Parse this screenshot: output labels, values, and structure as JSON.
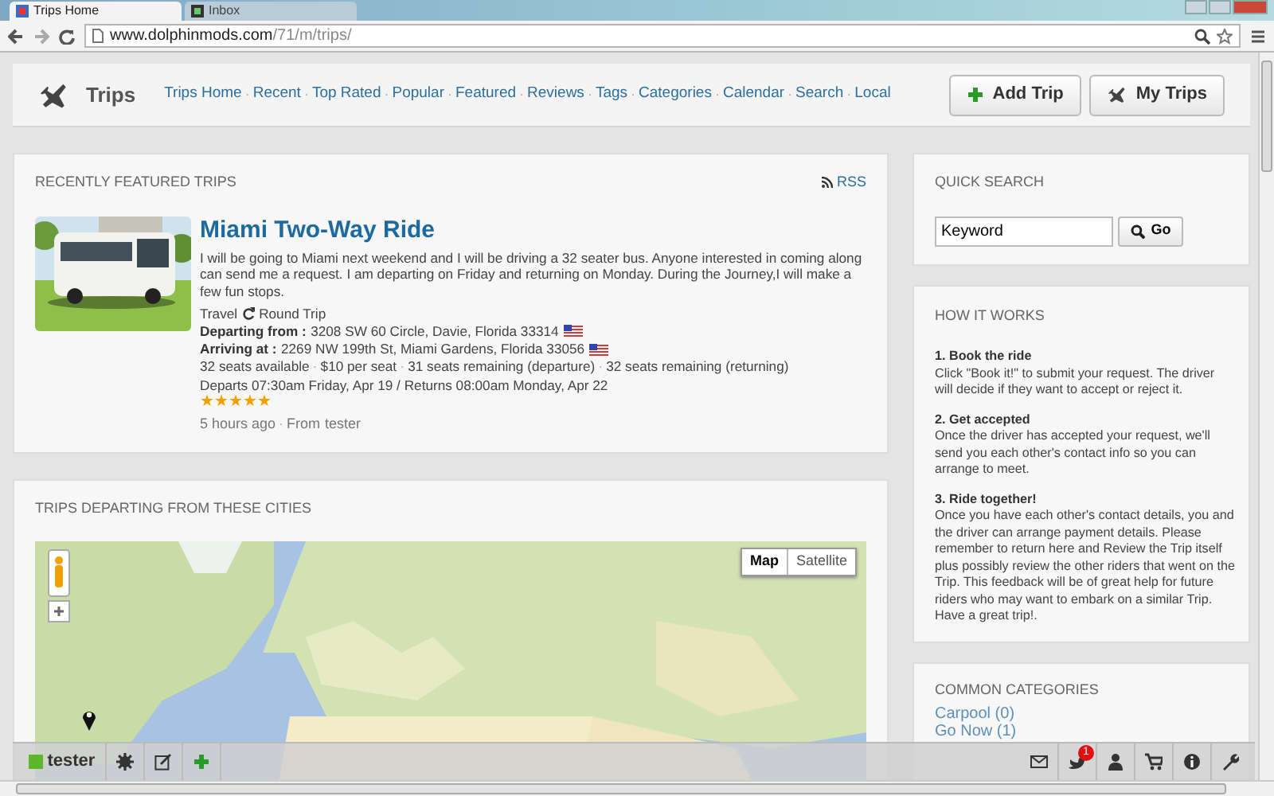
{
  "browser": {
    "tabs": [
      {
        "title": "Trips Home",
        "selected": true
      },
      {
        "title": "Inbox",
        "selected": false
      }
    ],
    "url_host": "www.dolphinmods.com",
    "url_path": "/71/m/trips/"
  },
  "header": {
    "title": "Trips",
    "separator": "·",
    "nav": [
      "Trips Home",
      "Recent",
      "Top Rated",
      "Popular",
      "Featured",
      "Reviews",
      "Tags",
      "Categories",
      "Calendar",
      "Search",
      "Local"
    ],
    "buttons": [
      {
        "label": "Add Trip",
        "kind": "add"
      },
      {
        "label": "My Trips",
        "kind": "plane"
      }
    ]
  },
  "featured": {
    "heading": "RECENTLY FEATURED TRIPS",
    "rss": "RSS",
    "trip": {
      "title": "Miami Two-Way Ride",
      "description": "I will be going to Miami next weekend and I will be driving a 32 seater bus. Anyone interested in coming along can send me a request. I am departing on Friday and returning on Monday. During the Journey,I will make a few fun stops.",
      "category": "Travel",
      "trip_type": "Round Trip",
      "departing_label": "Departing from :",
      "departing": "3208 SW 60 Circle, Davie, Florida 33314",
      "arriving_label": "Arriving at :",
      "arriving": "2269 NW 199th St, Miami Gardens, Florida 33056",
      "separator": "·",
      "facts": [
        "32 seats available",
        "$10 per seat",
        "31 seats remaining (departure)",
        "32 seats remaining (returning)"
      ],
      "schedule": "Departs 07:30am Friday, Apr 19 / Returns 08:00am Monday, Apr 22",
      "stars": 5,
      "time": "5 hours ago",
      "from_label": "From",
      "author": "tester"
    }
  },
  "map_panel": {
    "heading": "TRIPS DEPARTING FROM THESE CITIES",
    "map_types": [
      {
        "label": "Map",
        "selected": true
      },
      {
        "label": "Satellite",
        "selected": false
      }
    ]
  },
  "quick_search": {
    "heading": "QUICK SEARCH",
    "value": "Keyword",
    "button": "Go"
  },
  "how_it_works": {
    "heading": "HOW IT WORKS",
    "steps": [
      {
        "title": "1. Book the ride",
        "text": "Click \"Book it!\" to submit your request. The driver will decide if they want to accept or reject it."
      },
      {
        "title": "2. Get accepted",
        "text": "Once the driver has accepted your request, we'll send you each other's contact info so you can arrange to meet."
      },
      {
        "title": "3. Ride together!",
        "text": "Once you have each other's contact details, you and the driver can arrange payment details. Please remember to return here and Review the Trip itself plus possibly review the other riders that went on the Trip. This feedback will be of great help for future riders who may want to embark on a similar Trip. Have a great trip!."
      }
    ]
  },
  "categories": {
    "heading": "COMMON CATEGORIES",
    "items": [
      "Carpool (0)",
      "Go Now (1)"
    ]
  },
  "toolbar": {
    "user": "tester",
    "notification_count": "1"
  }
}
